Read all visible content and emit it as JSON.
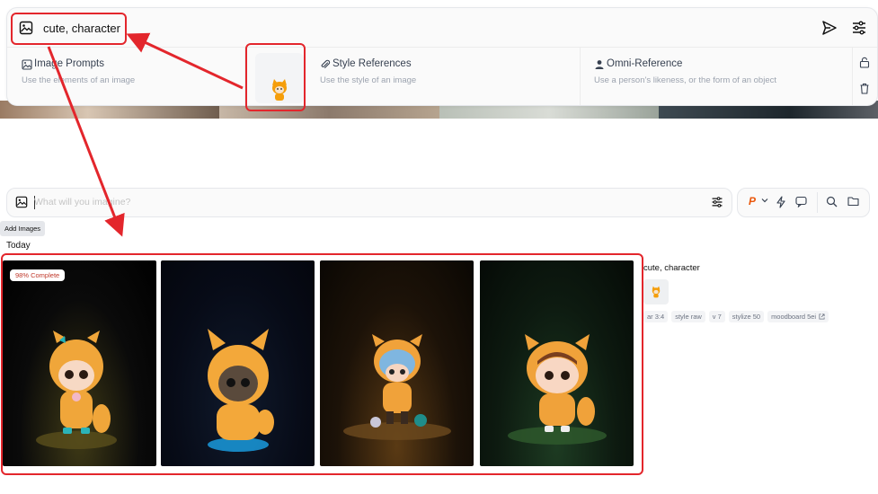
{
  "prompt_bar": {
    "text": "cute, character"
  },
  "reference_panel": {
    "columns": [
      {
        "title": "Image Prompts",
        "subtitle": "Use the elements of an image",
        "icon": "image-icon"
      },
      {
        "title": "Style References",
        "subtitle": "Use the style of an image",
        "icon": "paperclip-icon"
      },
      {
        "title": "Omni-Reference",
        "subtitle": "Use a person's likeness, or the form of an object",
        "icon": "person-icon"
      }
    ]
  },
  "search_bar": {
    "placeholder": "What will you imagine?"
  },
  "toolbar": {
    "personalize_label": "P"
  },
  "add_images_label": "Add Images",
  "section_label": "Today",
  "job": {
    "progress_label": "98% Complete",
    "progress_percent": 98,
    "prompt": "cute, character",
    "tags": [
      "ar 3:4",
      "style raw",
      "v 7",
      "stylize 50",
      "moodboard 5ei"
    ]
  },
  "colors": {
    "annotation": "#e3262c",
    "accent_orange": "#f59e0b",
    "personalize": "#ea580c"
  }
}
